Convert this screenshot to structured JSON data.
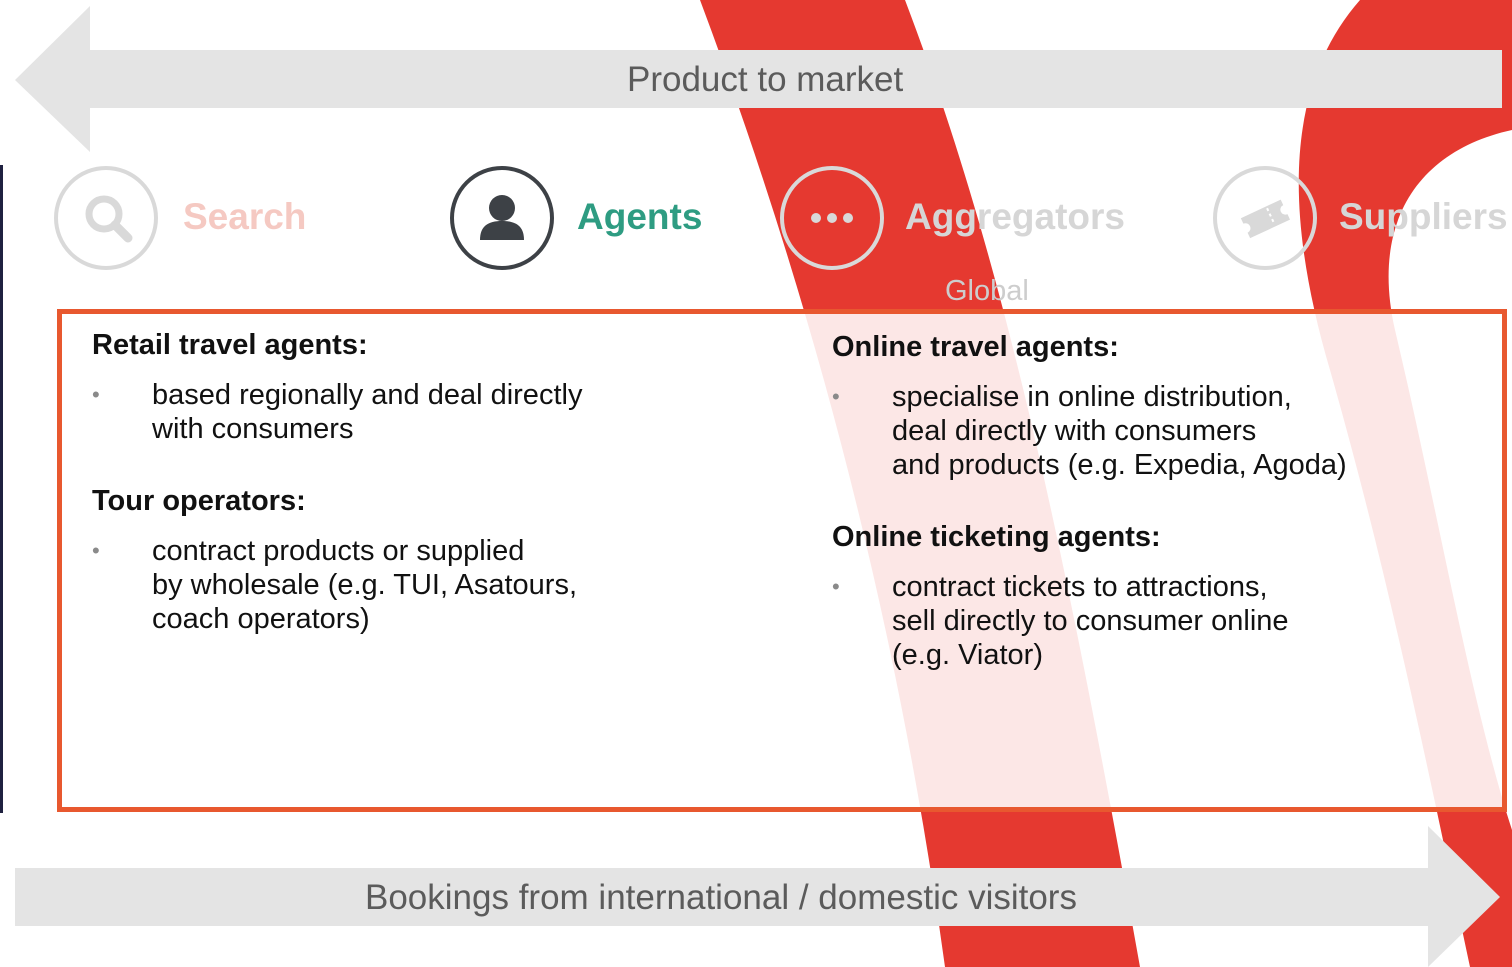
{
  "top_arrow": {
    "label": "Product to market"
  },
  "bottom_arrow": {
    "label": "Bookings from international / domestic visitors"
  },
  "steps": [
    {
      "label": "Search",
      "icon": "search-icon",
      "state": "inactive"
    },
    {
      "label": "Agents",
      "icon": "person-icon",
      "state": "active"
    },
    {
      "label": "Aggregators",
      "icon": "ellipsis-icon",
      "state": "inactive"
    },
    {
      "label": "Suppliers",
      "icon": "ticket-icon",
      "state": "inactive"
    }
  ],
  "aggregators_sublabel": "Global",
  "colors": {
    "active_label": "#2e9c82",
    "active_circle": "#3d4146",
    "inactive_circle": "#d9d9d9",
    "box_border": "#e8582f",
    "arrow_fill": "#e4e4e4",
    "background_swoosh": "#e2231a"
  },
  "left_column": [
    {
      "heading": "Retail travel agents:",
      "bullets": [
        "based regionally and deal directly\nwith consumers"
      ]
    },
    {
      "heading": "Tour operators:",
      "bullets": [
        "contract products or supplied\nby wholesale (e.g. TUI, Asatours,\ncoach operators)"
      ]
    }
  ],
  "right_column": [
    {
      "heading": "Online travel agents:",
      "bullets": [
        "specialise in online distribution,\ndeal directly with consumers\nand products (e.g. Expedia, Agoda)"
      ]
    },
    {
      "heading": "Online ticketing agents:",
      "bullets": [
        "contract tickets to attractions,\nsell directly to consumer online\n(e.g. Viator)"
      ]
    }
  ],
  "bullet_glyph": "•"
}
